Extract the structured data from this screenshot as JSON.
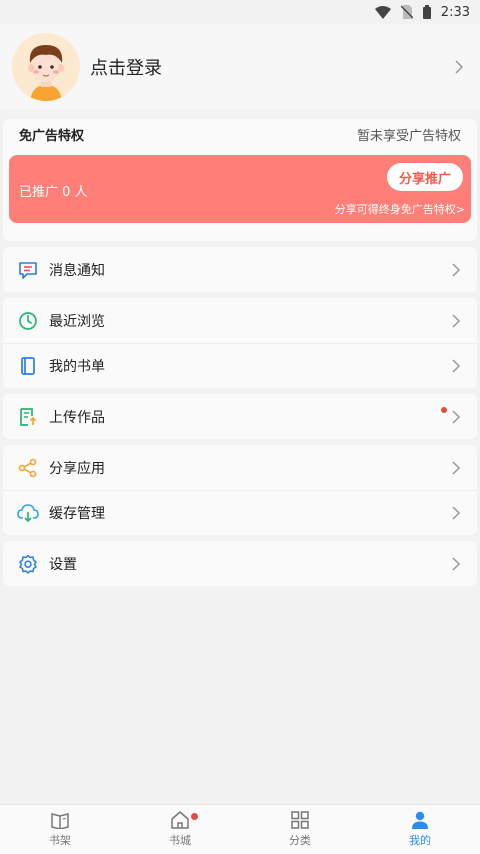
{
  "status_bar": {
    "time": "2:33"
  },
  "profile": {
    "login_label": "点击登录"
  },
  "ad_free": {
    "title": "免广告特权",
    "status": "暂未享受广告特权",
    "promoted_count_text": "已推广 0 人",
    "share_button": "分享推广",
    "share_tip": "分享可得终身免广告特权>"
  },
  "menu_groups": [
    [
      {
        "label": "消息通知",
        "icon": "message-icon"
      }
    ],
    [
      {
        "label": "最近浏览",
        "icon": "clock-icon"
      },
      {
        "label": "我的书单",
        "icon": "book-icon"
      }
    ],
    [
      {
        "label": "上传作品",
        "icon": "upload-doc-icon",
        "badge": true
      }
    ],
    [
      {
        "label": "分享应用",
        "icon": "share-icon"
      },
      {
        "label": "缓存管理",
        "icon": "cloud-download-icon"
      }
    ],
    [
      {
        "label": "设置",
        "icon": "settings-gear-icon"
      }
    ]
  ],
  "tabbar": {
    "tabs": [
      {
        "label": "书架",
        "icon": "bookshelf-icon"
      },
      {
        "label": "书城",
        "icon": "home-icon",
        "badge": true
      },
      {
        "label": "分类",
        "icon": "category-grid-icon"
      },
      {
        "label": "我的",
        "icon": "person-icon",
        "active": true
      }
    ]
  },
  "colors": {
    "accent": "#2a8cf0",
    "promo_bg": "#fe7f77",
    "badge": "#e8493f"
  }
}
